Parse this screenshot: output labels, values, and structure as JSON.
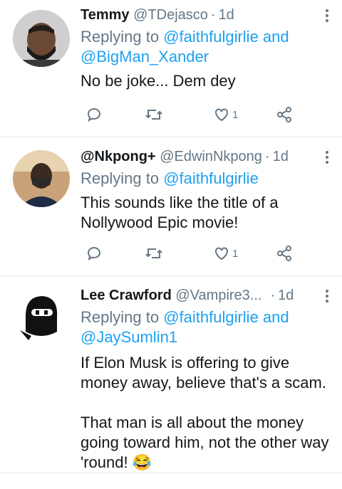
{
  "tweets": [
    {
      "name": "Temmy",
      "handle": "@TDejasco",
      "time": "1d",
      "reply_prefix": "Replying to ",
      "reply_line1": "@faithfulgirlie and",
      "reply_line2": "@BigMan_Xander",
      "text_lines": [
        "No be joke... Dem dey"
      ],
      "likes": "1"
    },
    {
      "name": "@Nkpong+",
      "handle": "@EdwinNkpong",
      "time": "1d",
      "reply_prefix": "Replying to ",
      "reply_line1": "@faithfulgirlie",
      "text_lines": [
        "This sounds like the title of a",
        "Nollywood Epic movie!"
      ],
      "likes": "1"
    },
    {
      "name": "Lee Crawford",
      "handle": "@Vampire3...",
      "time": "1d",
      "reply_prefix": "Replying to ",
      "reply_line1": "@faithfulgirlie and",
      "reply_line2": "@JaySumlin1",
      "text_lines": [
        "If Elon Musk is offering to give",
        "money away, believe that's a scam.",
        "",
        "That man is all about the money",
        "going toward him, not the other way",
        "'round! 😂"
      ]
    }
  ],
  "colors": {
    "link": "#1da1f2",
    "muted": "#657786",
    "text": "#14171a",
    "divider": "#e1e8ed"
  },
  "icons": [
    "reply-icon",
    "retweet-icon",
    "like-icon",
    "share-icon",
    "more-icon"
  ]
}
